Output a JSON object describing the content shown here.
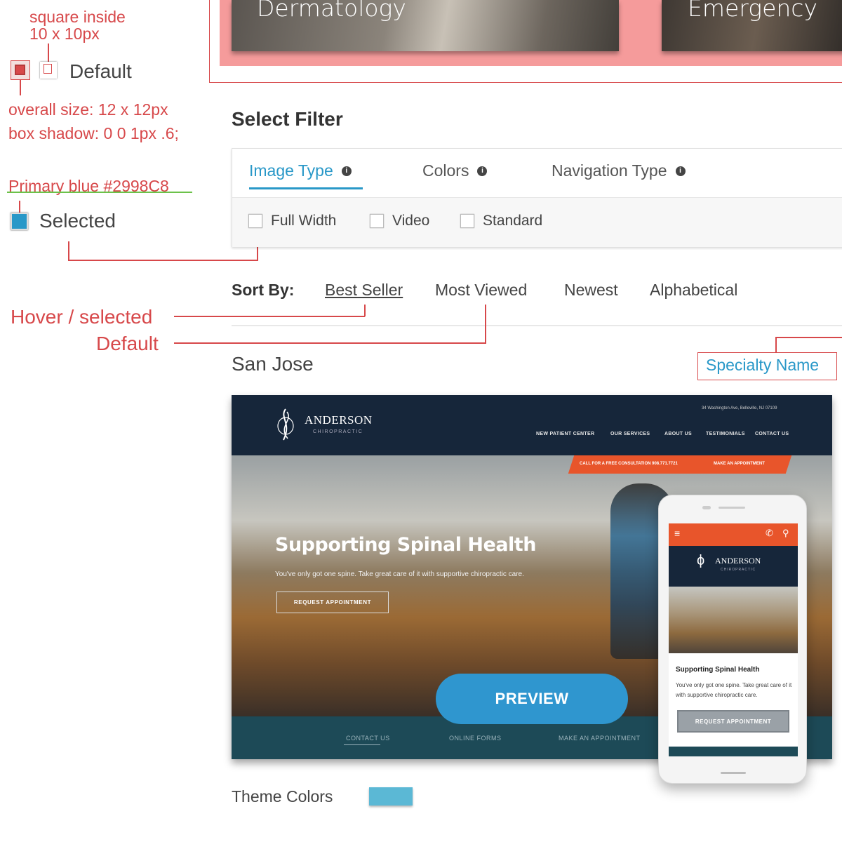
{
  "annotations": {
    "square_inside_line1": "square inside",
    "square_inside_line2": "10 x 10px",
    "overall_size": "overall size: 12 x 12px",
    "box_shadow": "box shadow: 0 0 1px .6;",
    "primary_blue": "Primary blue #2998C8",
    "hover_selected": "Hover / selected",
    "default": "Default",
    "specialty_name": "Specialty Name"
  },
  "legend": {
    "default_label": "Default",
    "selected_label": "Selected",
    "selected_color": "#2998C8",
    "annotation_color": "#d7484a"
  },
  "specialties": [
    {
      "label": "Dermatology"
    },
    {
      "label": "Emergency"
    }
  ],
  "filter": {
    "heading": "Select Filter",
    "tabs": [
      {
        "label": "Image Type",
        "active": true
      },
      {
        "label": "Colors",
        "active": false
      },
      {
        "label": "Navigation Type",
        "active": false
      }
    ],
    "options": [
      "Full Width",
      "Video",
      "Standard"
    ]
  },
  "sort": {
    "label": "Sort By:",
    "options": [
      "Best Seller",
      "Most Viewed",
      "Newest",
      "Alphabetical"
    ],
    "active": "Best Seller"
  },
  "theme": {
    "name": "San Jose",
    "specialty_link": "Specialty Name",
    "colors_label": "Theme Colors",
    "swatch_color": "#5bb8d5"
  },
  "preview_site": {
    "brand": "ANDERSON",
    "brand_sub": "CHIROPRACTIC",
    "address": "34 Washington Ave, Belleville, NJ 07109",
    "nav": [
      "NEW PATIENT CENTER",
      "OUR SERVICES",
      "ABOUT US",
      "TESTIMONIALS",
      "CONTACT US"
    ],
    "cta_call": "CALL FOR A FREE CONSULTATION 908.771.7721",
    "cta_appt": "MAKE AN APPOINTMENT",
    "hero_title": "Supporting Spinal Health",
    "hero_text": "You've only got one spine. Take great care of it with supportive chiropractic care.",
    "hero_button": "REQUEST APPOINTMENT",
    "footer_links": [
      "CONTACT US",
      "ONLINE FORMS",
      "MAKE AN APPOINTMENT"
    ],
    "preview_button": "PREVIEW",
    "mobile_title": "Supporting Spinal Health",
    "mobile_text": "You've only got one spine. Take great care of it with supportive chiropractic care.",
    "mobile_button": "REQUEST APPOINTMENT"
  }
}
